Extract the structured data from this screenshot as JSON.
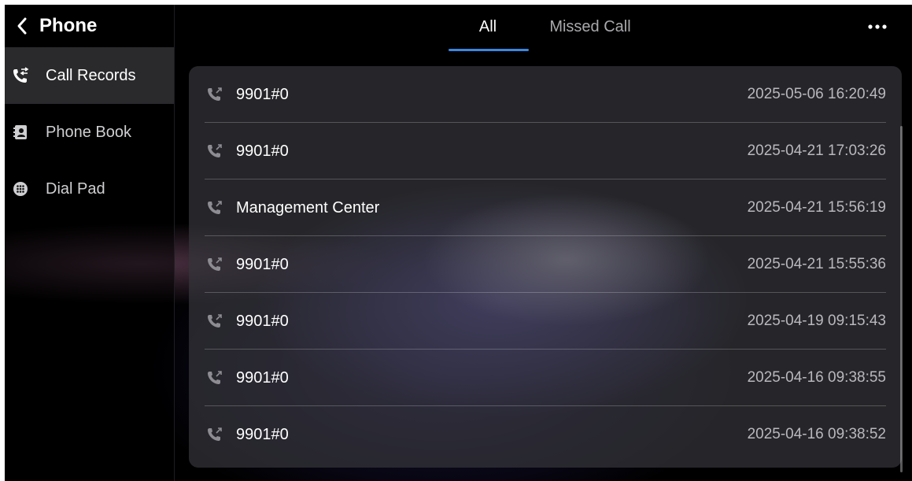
{
  "header": {
    "title": "Phone"
  },
  "sidebar": {
    "items": [
      {
        "label": "Call Records",
        "icon": "call-records-icon",
        "active": true
      },
      {
        "label": "Phone Book",
        "icon": "phone-book-icon",
        "active": false
      },
      {
        "label": "Dial Pad",
        "icon": "dial-pad-icon",
        "active": false
      }
    ]
  },
  "tabs": [
    {
      "label": "All",
      "active": true
    },
    {
      "label": "Missed Call",
      "active": false
    }
  ],
  "more_icon": "more-icon",
  "calls": [
    {
      "name": "9901#0",
      "time": "2025-05-06 16:20:49",
      "icon": "outgoing-call-icon"
    },
    {
      "name": "9901#0",
      "time": "2025-04-21 17:03:26",
      "icon": "outgoing-call-icon"
    },
    {
      "name": "Management Center",
      "time": "2025-04-21 15:56:19",
      "icon": "outgoing-call-icon"
    },
    {
      "name": "9901#0",
      "time": "2025-04-21 15:55:36",
      "icon": "outgoing-call-icon"
    },
    {
      "name": "9901#0",
      "time": "2025-04-19 09:15:43",
      "icon": "outgoing-call-icon"
    },
    {
      "name": "9901#0",
      "time": "2025-04-16 09:38:55",
      "icon": "outgoing-call-icon"
    },
    {
      "name": "9901#0",
      "time": "2025-04-16 09:38:52",
      "icon": "outgoing-call-icon"
    }
  ],
  "colors": {
    "accent": "#3b86e0",
    "active_item_bg": "#2a2a2d",
    "panel_bg": "#34343a"
  }
}
